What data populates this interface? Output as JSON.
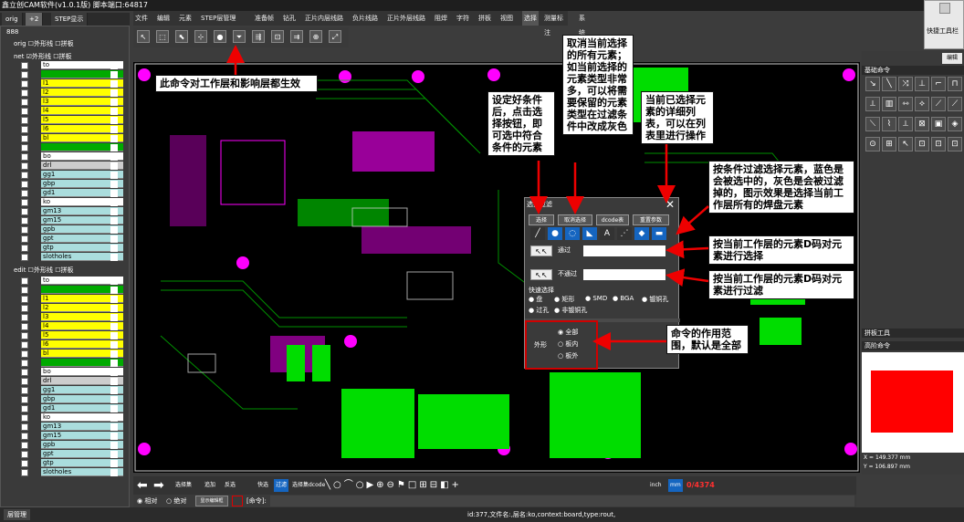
{
  "window": {
    "title": "鑫立创CAM软件(v1.0.1版) 脚本端口:64817",
    "quick_toolbar": "快捷工具栏",
    "edit": "编辑"
  },
  "left_tabs": [
    "orig",
    "+2",
    "STEP显示"
  ],
  "menus": [
    "文件",
    "编辑",
    "元素",
    "STEP层管理",
    "准备帧",
    "钻孔",
    "正片内层线路",
    "负片线路",
    "正片外层线路",
    "阻焊",
    "字符",
    "拼板",
    "视图",
    "选择",
    "测量标注",
    "系统"
  ],
  "tree": {
    "root": "888",
    "orig": {
      "label": "orig",
      "outline": "外形线",
      "panel": "拼板"
    },
    "net": {
      "label": "net",
      "outline": "外形线",
      "panel": "拼板"
    },
    "edit": {
      "label": "edit",
      "outline": "外形线",
      "panel": "拼板"
    }
  },
  "layers_net": [
    {
      "name": "to",
      "color": "#ffffff"
    },
    {
      "name": "",
      "color": "#00aa00"
    },
    {
      "name": "l1",
      "color": "#ffff00"
    },
    {
      "name": "l2",
      "color": "#ffff00"
    },
    {
      "name": "l3",
      "color": "#ffff00"
    },
    {
      "name": "l4",
      "color": "#ffff00"
    },
    {
      "name": "l5",
      "color": "#ffff00"
    },
    {
      "name": "l6",
      "color": "#ffff00"
    },
    {
      "name": "bl",
      "color": "#ffff00"
    },
    {
      "name": "",
      "color": "#00aa00"
    },
    {
      "name": "bo",
      "color": "#ffffff"
    },
    {
      "name": "drl",
      "color": "#cccccc"
    },
    {
      "name": "gg1",
      "color": "#aadddd"
    },
    {
      "name": "gbp",
      "color": "#aadddd"
    },
    {
      "name": "gd1",
      "color": "#aadddd"
    },
    {
      "name": "ko",
      "color": "#ffffff"
    },
    {
      "name": "gm13",
      "color": "#aadddd"
    },
    {
      "name": "gm15",
      "color": "#aadddd"
    },
    {
      "name": "gpb",
      "color": "#aadddd"
    },
    {
      "name": "gpt",
      "color": "#aadddd"
    },
    {
      "name": "gtp",
      "color": "#aadddd"
    },
    {
      "name": "slotholes",
      "color": "#aadddd"
    }
  ],
  "layers_edit": [
    {
      "name": "to",
      "color": "#ffffff"
    },
    {
      "name": "",
      "color": "#00aa00"
    },
    {
      "name": "l1",
      "color": "#ffff00"
    },
    {
      "name": "l2",
      "color": "#ffff00"
    },
    {
      "name": "l3",
      "color": "#ffff00"
    },
    {
      "name": "l4",
      "color": "#ffff00"
    },
    {
      "name": "l5",
      "color": "#ffff00"
    },
    {
      "name": "l6",
      "color": "#ffff00"
    },
    {
      "name": "bl",
      "color": "#ffff00"
    },
    {
      "name": "",
      "color": "#00aa00"
    },
    {
      "name": "bo",
      "color": "#ffffff"
    },
    {
      "name": "drl",
      "color": "#cccccc"
    },
    {
      "name": "gg1",
      "color": "#aadddd"
    },
    {
      "name": "gbp",
      "color": "#aadddd"
    },
    {
      "name": "gd1",
      "color": "#aadddd"
    },
    {
      "name": "ko",
      "color": "#ffffff"
    },
    {
      "name": "gm13",
      "color": "#aadddd"
    },
    {
      "name": "gm15",
      "color": "#aadddd"
    },
    {
      "name": "gpb",
      "color": "#aadddd"
    },
    {
      "name": "gpt",
      "color": "#aadddd"
    },
    {
      "name": "gtp",
      "color": "#aadddd"
    },
    {
      "name": "slotholes",
      "color": "#aadddd"
    }
  ],
  "dialog": {
    "title": "选择过滤",
    "buttons": [
      "选择",
      "取消选择",
      "dcode表",
      "重置参数"
    ],
    "pass_label": "通过",
    "reject_label": "不通过",
    "quick_select": "快速选择",
    "quick_options": [
      "盘",
      "矩形",
      "SMD",
      "BGA",
      "镀铜孔",
      "过孔",
      "非镀铜孔"
    ],
    "shape_label": "外形",
    "shape_options": [
      "全部",
      "板内",
      "板外"
    ]
  },
  "callouts": {
    "c1": "此命令对工作层和影响层都生效",
    "c2": "设定好条件后，点击选择按钮，即可选中符合条件的元素",
    "c3": "取消当前选择的所有元素；如当前选择的元素类型非常多，可以将需要保留的元素类型在过滤条件中改成灰色",
    "c4": "当前已选择元素的详细列表，可以在列表里进行操作",
    "c5": "按条件过滤选择元素，蓝色是会被选中的，灰色是会被过滤掉的，图示效果是选择当前工作层所有的焊盘元素",
    "c6": "按当前工作层的元素D码对元素进行选择",
    "c7": "按当前工作层的元素D码对元素进行过滤",
    "c8": "命令的作用范围，默认是全部"
  },
  "right_panel": {
    "basic_cmd": "基础命令",
    "panel_tool": "拼板工具",
    "advanced_cmd": "高阶命令",
    "coord_x": "X = 149.377 mm",
    "coord_y": "Y = 106.897 mm"
  },
  "bottom": {
    "items": [
      "选择集",
      "追加",
      "反选",
      "快选",
      "过滤",
      "选择集dcode",
      "inch",
      "mm"
    ],
    "counter": "0/4374",
    "opt_rel": "相对",
    "opt_abs": "绝对",
    "editor": "显示编辑框",
    "cmd_prompt": "[命令]:",
    "layer_mgr": "层管理",
    "status": "id:377,文件名:,层名:ko,context:board,type:rout,"
  }
}
